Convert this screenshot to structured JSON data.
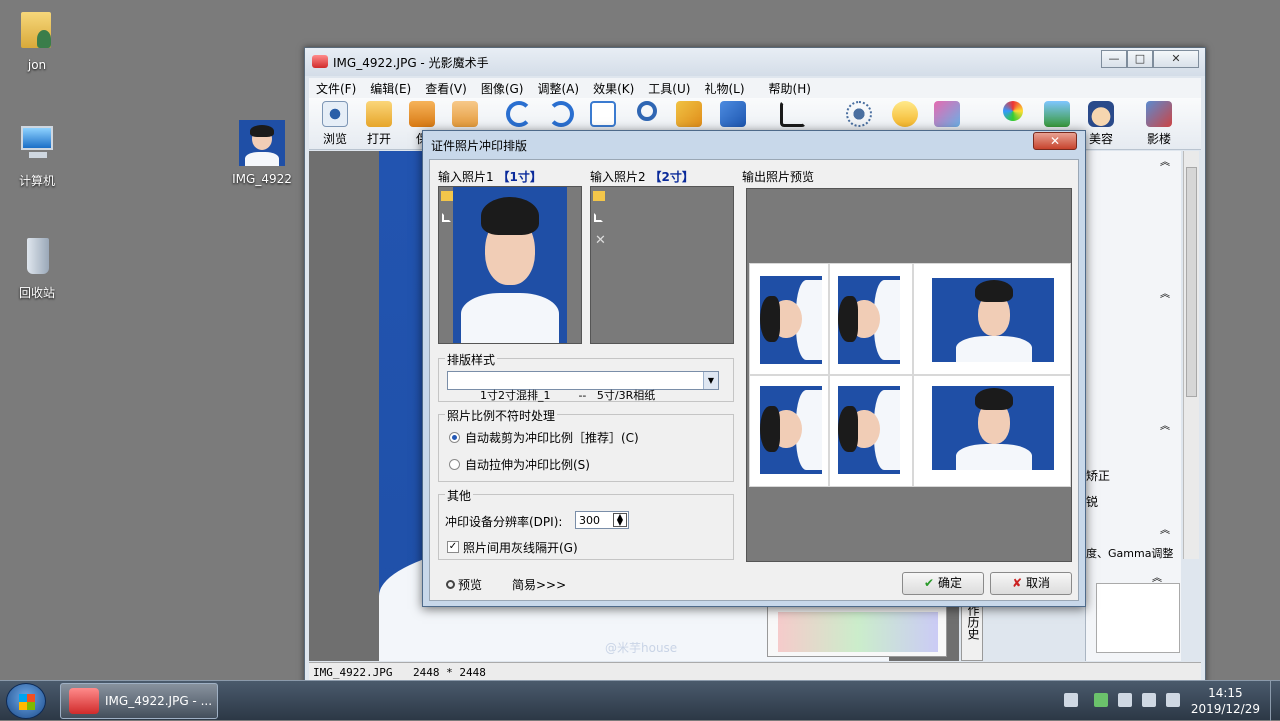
{
  "desktop": {
    "icons": [
      {
        "label": "jon"
      },
      {
        "label": "计算机"
      },
      {
        "label": "回收站"
      },
      {
        "label": "IMG_4922"
      }
    ]
  },
  "main_window": {
    "title": "IMG_4922.JPG - 光影魔术手",
    "controls": {
      "minimize": "—",
      "maximize": "□",
      "close": "✕"
    },
    "menu": [
      "文件(F)",
      "编辑(E)",
      "查看(V)",
      "图像(G)",
      "调整(A)",
      "效果(K)",
      "工具(U)",
      "礼物(L)",
      "帮助(H)"
    ],
    "toolbar": [
      {
        "label": "浏览",
        "icon": "eye-icon"
      },
      {
        "label": "打开",
        "icon": "folder-open-icon"
      },
      {
        "label": "保",
        "icon": "save-icon"
      },
      {
        "label": "",
        "icon": "print-icon"
      },
      {
        "label": "",
        "icon": "rotate-left-icon"
      },
      {
        "label": "",
        "icon": "rotate-right-icon"
      },
      {
        "label": "",
        "icon": "calendar-icon"
      },
      {
        "label": "",
        "icon": "zoom-icon"
      },
      {
        "label": "",
        "icon": "resize-icon"
      },
      {
        "label": "",
        "icon": "arrows-icon"
      },
      {
        "label": "",
        "icon": "crop-icon"
      },
      {
        "label": "",
        "icon": "brightness-icon"
      },
      {
        "label": "",
        "icon": "bulb-icon"
      },
      {
        "label": "",
        "icon": "image-icon"
      },
      {
        "label": "",
        "icon": "magnifier-color-icon"
      },
      {
        "label": "",
        "icon": "picture-icon"
      },
      {
        "label": "美容",
        "icon": "face-icon"
      },
      {
        "label": "影楼",
        "icon": "studio-icon"
      }
    ],
    "right_panel": {
      "items": [
        "矫正",
        "锐",
        "度、Gamma调整"
      ],
      "history_tab": "作历史"
    },
    "watermark": "@米芋house",
    "status": {
      "file": "IMG_4922.JPG",
      "size": "2448 * 2448"
    }
  },
  "dialog": {
    "title": "证件照片冲印排版",
    "close": "✕",
    "input1": {
      "label": "输入照片1",
      "size": "【1寸】"
    },
    "input2": {
      "label": "输入照片2",
      "size": "【2寸】"
    },
    "preview_label": "输出照片预览",
    "layout_group": {
      "title": "排版样式",
      "selected": "1寸2寸混排_1        --   5寸/3R相纸"
    },
    "ratio_group": {
      "title": "照片比例不符时处理",
      "options": [
        {
          "label": "自动裁剪为冲印比例［推荐］(C)",
          "checked": true
        },
        {
          "label": "自动拉伸为冲印比例(S)",
          "checked": false
        }
      ]
    },
    "other_group": {
      "title": "其他",
      "dpi_label": "冲印设备分辨率(DPI):",
      "dpi_value": "300",
      "gray_line_label": "照片间用灰线隔开(G)",
      "gray_line_checked": true,
      "check_mark": "✓"
    },
    "preview_button": "预览",
    "simple_button": "简易>>>",
    "ok_button": "确定",
    "cancel_button": "取消"
  },
  "taskbar": {
    "task_label": "IMG_4922.JPG - ...",
    "time": "14:15",
    "date": "2019/12/29"
  }
}
